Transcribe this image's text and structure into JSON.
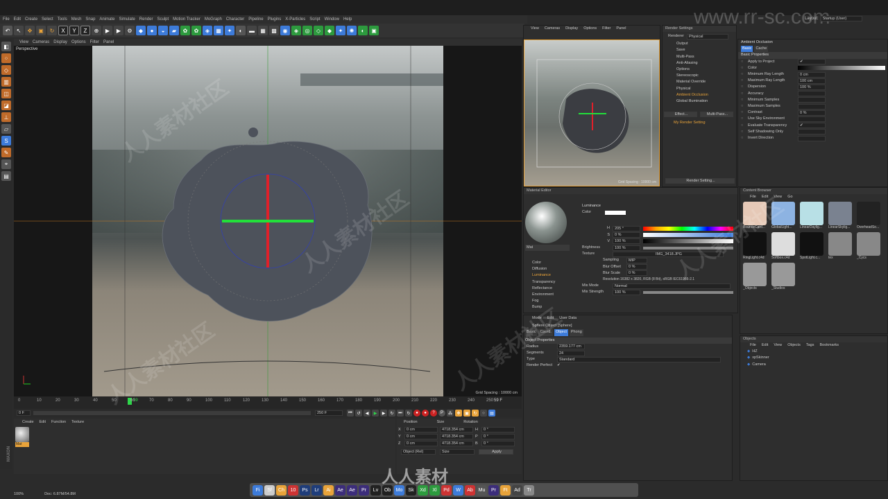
{
  "menu": [
    "File",
    "Edit",
    "Create",
    "Select",
    "Tools",
    "Mesh",
    "Snap",
    "Animate",
    "Simulate",
    "Render",
    "Sculpt",
    "Motion Tracker",
    "MoGraph",
    "Character",
    "Pipeline",
    "Plugins",
    "X-Particles",
    "Script",
    "Window",
    "Help"
  ],
  "layout": {
    "label": "Layout:",
    "value": "Startup (User)"
  },
  "watermark_url": "www.rr-sc.com",
  "watermark_cn": "人人素材社区",
  "watermark_brand": "人人素材",
  "vp_menu": [
    "View",
    "Cameras",
    "Display",
    "Options",
    "Filter",
    "Panel"
  ],
  "vp_label": "Perspective",
  "vp_grid": "Grid Spacing : 10000 cm",
  "timeline": {
    "ticks": [
      "0",
      "10",
      "20",
      "30",
      "40",
      "50",
      "60",
      "70",
      "80",
      "90",
      "100",
      "110",
      "120",
      "130",
      "140",
      "150",
      "160",
      "170",
      "180",
      "190",
      "200",
      "210",
      "220",
      "230",
      "240",
      "250"
    ],
    "current": "59",
    "end": "59 F",
    "frame_field": "0 F",
    "max": "250 F"
  },
  "material_mgr": {
    "menu": [
      "Create",
      "Edit",
      "Function",
      "Texture"
    ],
    "mat": "Mat"
  },
  "coords": {
    "headers": [
      "Position",
      "Size",
      "Rotation"
    ],
    "rows": [
      [
        "X",
        "0 cm",
        "4718.354 cm",
        "H",
        "0 °"
      ],
      [
        "Y",
        "0 cm",
        "4718.354 cm",
        "P",
        "0 °"
      ],
      [
        "Z",
        "0 cm",
        "4718.354 cm",
        "B",
        "0 °"
      ]
    ],
    "mode": "Object (Rel)",
    "size_mode": "Size",
    "apply": "Apply"
  },
  "status": {
    "zoom": "100%",
    "doc": "Doc: 6.87M/54.8M"
  },
  "small_vp": {
    "menu": [
      "View",
      "Cameras",
      "Display",
      "Options",
      "Filter",
      "Panel"
    ],
    "grid": "Grid Spacing : 10000 cm"
  },
  "render": {
    "title": "Render Settings",
    "renderer_label": "Renderer",
    "renderer": "Physical",
    "items": [
      "Output",
      "Save",
      "Multi-Pass",
      "Anti-Aliasing",
      "Options",
      "Stereoscopic",
      "Material Override",
      "Physical",
      "Ambient Occlusion",
      "Global Illumination"
    ],
    "effect": "Effect...",
    "multipass": "Multi-Pass...",
    "my": "My Render Setting",
    "btn": "Render Setting..."
  },
  "ao": {
    "title": "Ambient Occlusion",
    "tabs": [
      "Basic",
      "Cache"
    ],
    "section": "Basic Properties",
    "rows": [
      [
        "Apply to Project",
        "✔"
      ],
      [
        "Color",
        ""
      ],
      [
        "Minimum Ray Length",
        "0 cm"
      ],
      [
        "Maximum Ray Length",
        "100 cm"
      ],
      [
        "Dispersion",
        "100 %"
      ],
      [
        "Accuracy",
        ""
      ],
      [
        "Minimum Samples",
        ""
      ],
      [
        "Maximum Samples",
        ""
      ],
      [
        "Contrast",
        "0 %"
      ],
      [
        "Use Sky Environment",
        ""
      ],
      [
        "Evaluate Transparency",
        "✔"
      ],
      [
        "Self Shadowing Only",
        ""
      ],
      [
        "Invert Direction",
        ""
      ]
    ]
  },
  "mat_editor": {
    "title": "Material Editor",
    "name": "Mat",
    "channels": [
      "Color",
      "Diffusion",
      "Luminance",
      "Transparency",
      "Reflectance",
      "Environment",
      "Fog",
      "Bump"
    ],
    "lum": "Luminance",
    "color": "Color",
    "h": "205 °",
    "s": "0 %",
    "v": "100 %",
    "brightness_label": "Brightness",
    "brightness": "100 %",
    "texture_label": "Texture",
    "texture": "IMG_3418.JPG",
    "sampling_label": "Sampling",
    "sampling": "MIP",
    "blur_off_label": "Blur Offset",
    "blur_off": "0 %",
    "blur_scale_label": "Blur Scale",
    "blur_scale": "0 %",
    "resolution": "Resolution 16382 x 3820, RGB (8 Bit), sRGB IEC61966-2.1",
    "mix_mode_label": "Mix Mode",
    "mix_mode": "Normal",
    "mix_strength_label": "Mix Strength",
    "mix_strength": "100 %"
  },
  "attr": {
    "menu": [
      "Mode",
      "Edit",
      "User Data"
    ],
    "object": "Sphere Object [Sphere]",
    "tabs": [
      "Basic",
      "Coord.",
      "Object",
      "Phong"
    ],
    "section": "Object Properties",
    "rows": [
      [
        "Radius",
        "2359.177 cm"
      ],
      [
        "Segments",
        "24"
      ],
      [
        "Type",
        "Standard"
      ],
      [
        "Render Perfect",
        "✔"
      ]
    ]
  },
  "content": {
    "title": "Content Browser",
    "menu": [
      "File",
      "Edit",
      "View",
      "Go"
    ],
    "items": [
      "BounceCard...",
      "GlobalLight...",
      "LinearDaylig...",
      "LinearSkylig...",
      "OverheadSo...",
      "RingLight.c4d",
      "Softbox.c4d",
      "SpotLight.c...",
      "tex",
      "_Cycs",
      "_Objects",
      "_Studios"
    ]
  },
  "objects": {
    "title": "Objects",
    "menu": [
      "File",
      "Edit",
      "View",
      "Objects",
      "Tags",
      "Bookmarks"
    ],
    "items": [
      "HZ",
      "xpSkinner",
      "Camera"
    ]
  },
  "dock": [
    "Fi",
    "Sf",
    "Ch",
    "10",
    "Ps",
    "Lr",
    "Ai",
    "Ae",
    "Ae",
    "Pr",
    "Lv",
    "Ob",
    "Mo",
    "Sk",
    "Xd",
    "Xl",
    "Pd",
    "W",
    "Ab",
    "Mu",
    "Pr",
    "Ft",
    "Ad",
    "Tr"
  ],
  "colors": {
    "accent": "#e8a33a",
    "blue": "#3d7bd9"
  }
}
